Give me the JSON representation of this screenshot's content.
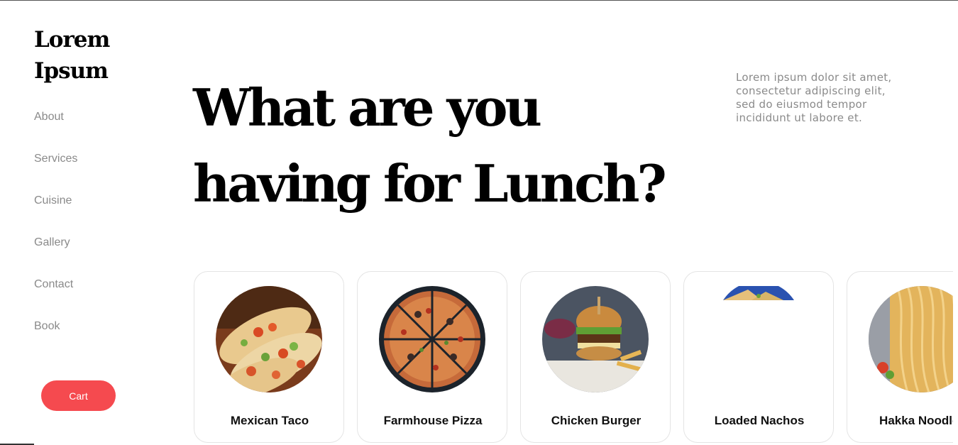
{
  "brand": {
    "line1": "Lorem",
    "line2": "Ipsum"
  },
  "nav": {
    "items": [
      "About",
      "Services",
      "Cuisine",
      "Gallery",
      "Contact",
      "Book"
    ]
  },
  "cart": {
    "label": "Cart"
  },
  "colors": {
    "accent": "#f54a4f",
    "nav_text": "#8a8a8a",
    "card_border": "#e4e4e4"
  },
  "hero": {
    "title_line1": "What are you",
    "title_line2": "having for Lunch?",
    "description": "Lorem ipsum dolor sit amet, consectetur adipiscing elit, sed do eiusmod tempor incididunt ut labore et."
  },
  "dishes": [
    {
      "name": "Mexican Taco",
      "image": "taco-photo"
    },
    {
      "name": "Farmhouse Pizza",
      "image": "pizza-photo"
    },
    {
      "name": "Chicken Burger",
      "image": "burger-photo"
    },
    {
      "name": "Loaded Nachos",
      "image": "nachos-photo"
    },
    {
      "name": "Hakka Noodles",
      "image": "noodles-photo"
    }
  ]
}
